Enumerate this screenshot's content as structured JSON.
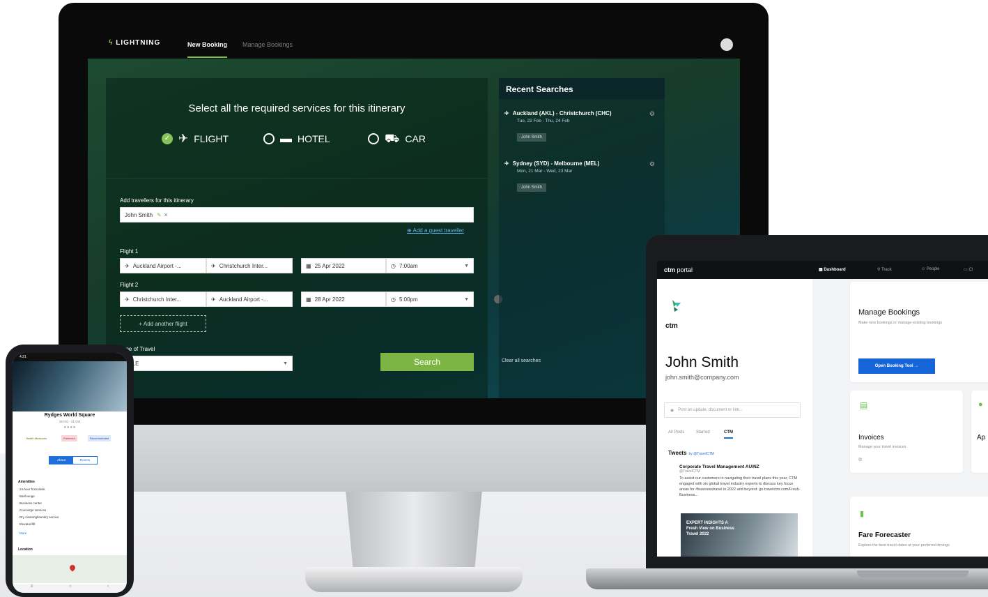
{
  "desktop": {
    "logo_text": "LIGHTNING",
    "nav": {
      "new_booking": "New Booking",
      "manage_bookings": "Manage Bookings"
    },
    "booking": {
      "title": "Select all the required services for this itinerary",
      "services": [
        {
          "label": "FLIGHT",
          "selected": true,
          "icon": "plane-icon"
        },
        {
          "label": "HOTEL",
          "selected": false,
          "icon": "bed-icon"
        },
        {
          "label": "CAR",
          "selected": false,
          "icon": "car-icon"
        }
      ],
      "travellers_label": "Add travellers for this itinerary",
      "traveller_name": "John Smith",
      "add_guest": "Add a guest traveller",
      "flight1": {
        "label": "Flight 1",
        "from": "Auckland Airport -...",
        "to": "Christchurch Inter...",
        "date": "25 Apr 2022",
        "time": "7:00am"
      },
      "flight2": {
        "label": "Flight 2",
        "from": "Christchurch Inter...",
        "to": "Auckland Airport -...",
        "date": "28 Apr 2022",
        "time": "5:00pm"
      },
      "add_flight": "+ Add another flight",
      "type_label": "Type of Travel",
      "type_value": "SALE",
      "search_label": "Search"
    },
    "recent": {
      "title": "Recent Searches",
      "items": [
        {
          "route": "Auckland (AKL) - Christchurch (CHC)",
          "dates": "Tue, 22 Feb - Thu, 24 Feb",
          "traveller": "John Smith"
        },
        {
          "route": "Sydney (SYD) - Melbourne (MEL)",
          "dates": "Mon, 21 Mar - Wed, 23 Mar",
          "traveller": "John Smith"
        }
      ],
      "clear": "Clear all searches"
    }
  },
  "laptop": {
    "brand_bold": "ctm",
    "brand_rest": " portal",
    "nav": {
      "dashboard": "Dashboard",
      "track": "Track",
      "people": "People",
      "more": "Cl"
    },
    "logo_text": "ctm",
    "user_name": "John Smith",
    "user_email": "john.smith@company.com",
    "post_placeholder": "Post an update, document or link...",
    "post_tabs": {
      "all": "All Posts",
      "starred": "Starred",
      "ctm": "CTM"
    },
    "tweets_title": "Tweets",
    "tweets_by": "by @TravelCTM",
    "tweet_author": "Corporate Travel Management AU/NZ",
    "tweet_handle": "@TravelCTM",
    "tweet_body": "To assist our customers in navigating their travel plans this year, CTM engaged with six global travel industry experts to discuss key focus areas for #businesstravel in 2022 and beyond: go.travelctm.com/Fresh-Business...",
    "tweet_image_text": "EXPERT INSIGHTS A Fresh View on Business Travel 2022",
    "manage": {
      "title": "Manage Bookings",
      "subtitle": "Make new bookings or manage existing bookings",
      "button": "Open Booking Tool →"
    },
    "invoices": {
      "title": "Invoices",
      "subtitle": "Manage your travel invoices"
    },
    "ap_title": "Ap",
    "fare": {
      "title": "Fare Forecaster",
      "subtitle": "Explore the best travel dates at your preferred timings"
    }
  },
  "phone": {
    "time": "4:21",
    "hotel_name": "Rydges World Square",
    "hotel_dates": "19 Oct - 21 Oct",
    "stars": "★★★★",
    "tags": {
      "health": "Health Measures",
      "preferred": "Preferred",
      "recommended": "Recommended"
    },
    "segments": {
      "first": "About",
      "second": "Rooms"
    },
    "amenities_title": "Amenities",
    "amenities": [
      "24-hour front desk",
      "Bar/lounge",
      "Business center",
      "Concierge services",
      "Dry cleaning/laundry service",
      "Elevator/lift"
    ],
    "more": "More",
    "location_title": "Location"
  }
}
